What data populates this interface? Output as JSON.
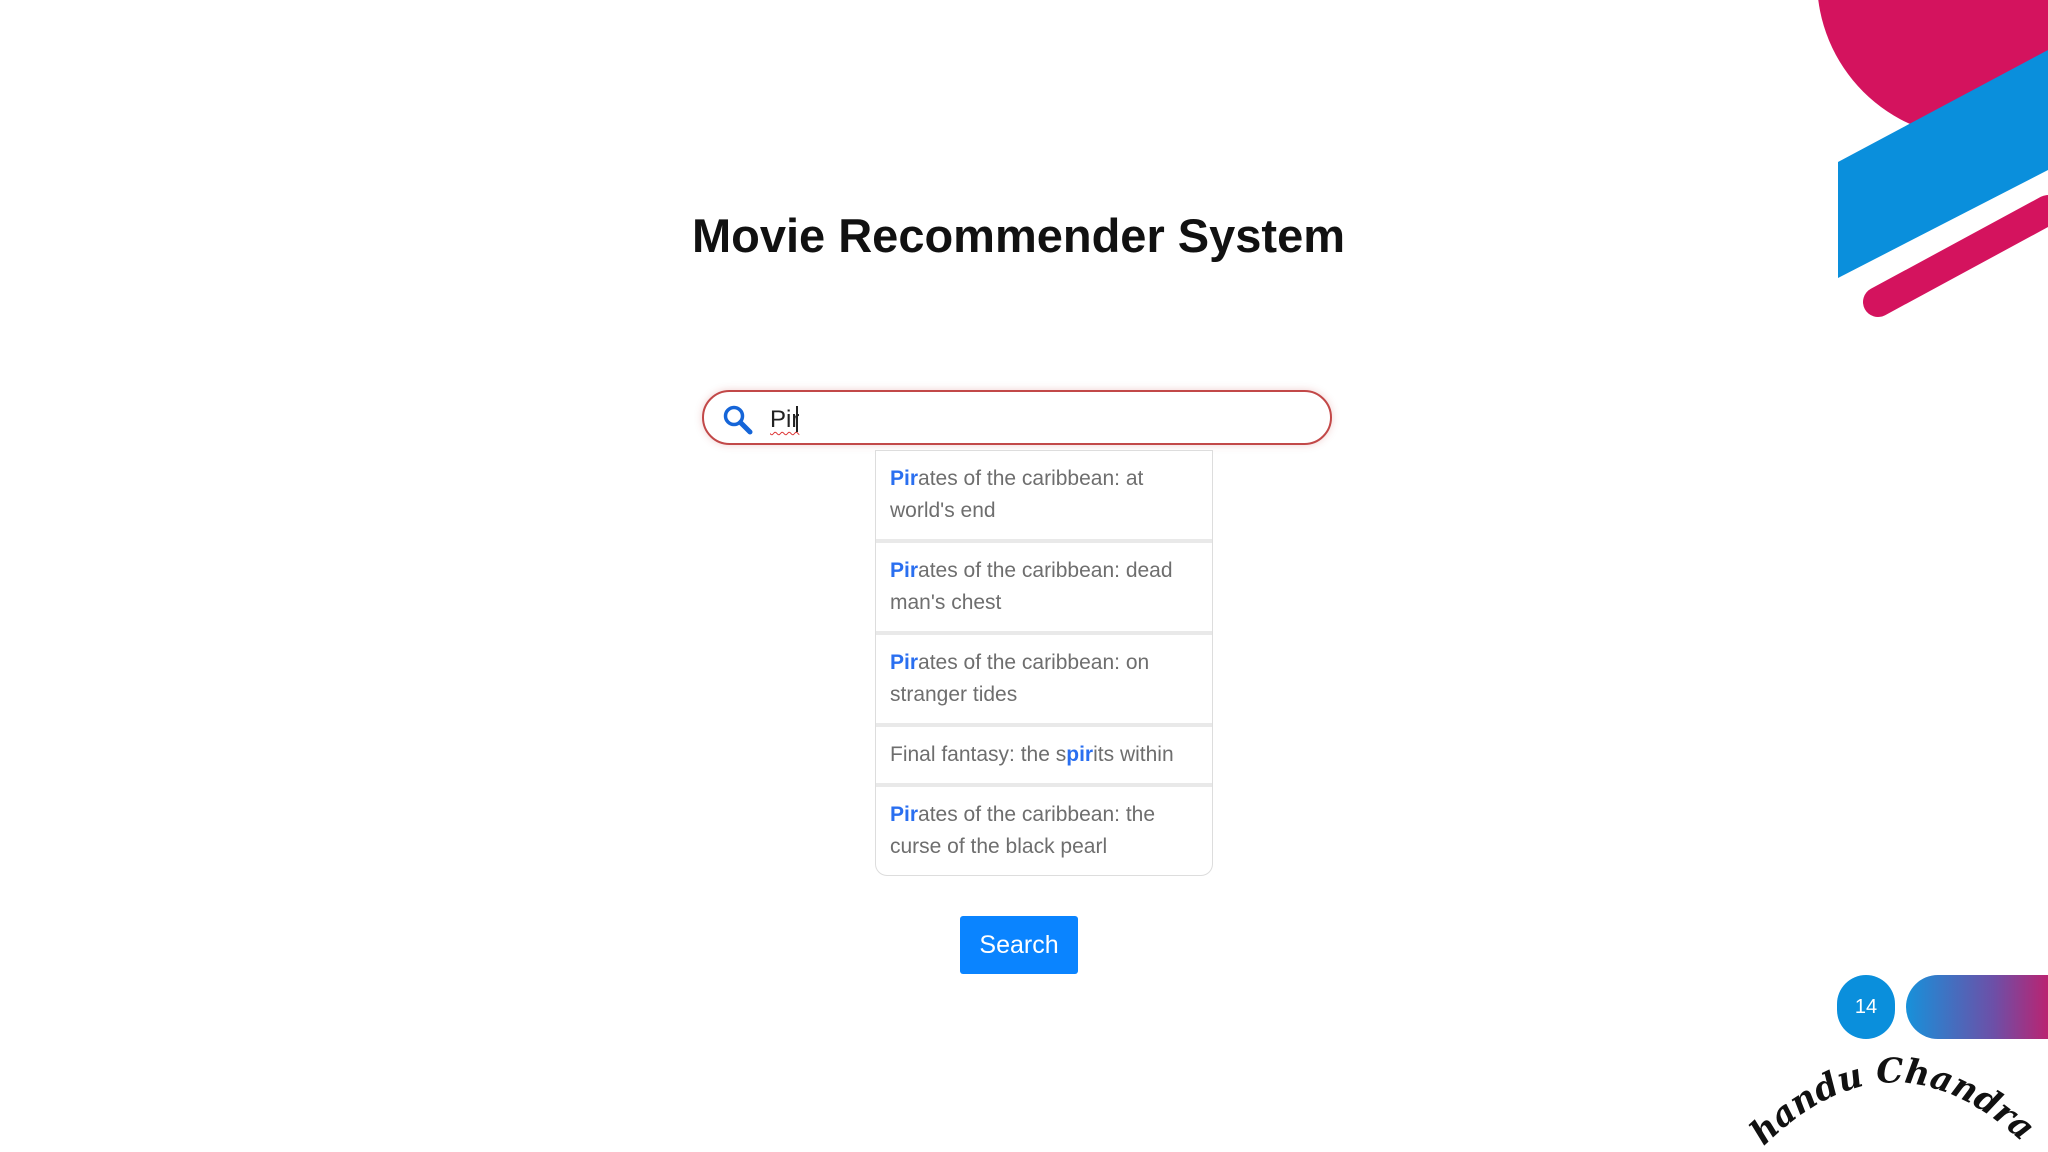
{
  "title": "Movie Recommender System",
  "search": {
    "value": "Pir"
  },
  "suggestions": [
    {
      "match": "Pir",
      "rest": "ates of the caribbean: at world's end"
    },
    {
      "match": "Pir",
      "rest": "ates of the caribbean: dead man's chest"
    },
    {
      "match": "Pir",
      "rest": "ates of the caribbean: on stranger tides"
    },
    {
      "before": "Final fantasy: the s",
      "match": "pir",
      "rest": "its within"
    },
    {
      "match": "Pir",
      "rest": "ates of the caribbean: the curse of the black pearl"
    }
  ],
  "search_button": "Search",
  "slide_number": "14",
  "signature": "Chandu Chandran",
  "colors": {
    "accent_blue": "#0a84ff",
    "magenta": "#d4155f",
    "deco_blue": "#0a8fdc",
    "match": "#2a6ff0"
  }
}
